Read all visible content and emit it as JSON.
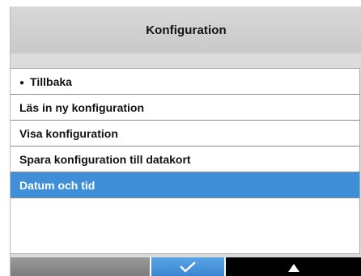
{
  "header": {
    "title": "Konfiguration"
  },
  "menu": {
    "items": [
      {
        "label": "Tillbaka",
        "bullet": "●",
        "selected": false
      },
      {
        "label": "Läs in ny konfiguration",
        "selected": false
      },
      {
        "label": "Visa konfiguration",
        "selected": false
      },
      {
        "label": "Spara konfiguration till datakort",
        "selected": false
      },
      {
        "label": "Datum och tid",
        "selected": true
      }
    ]
  },
  "softkeys": {
    "left": {
      "icon": "none"
    },
    "middle": {
      "icon": "checkmark-icon"
    },
    "right": {
      "icon": "up-arrow-icon"
    }
  },
  "colors": {
    "selection": "#3f8ed8",
    "title_bar": "#d0d0d0",
    "softkey_left": "#8a8a8a",
    "softkey_middle": "#4a95dc",
    "softkey_right": "#000000"
  }
}
